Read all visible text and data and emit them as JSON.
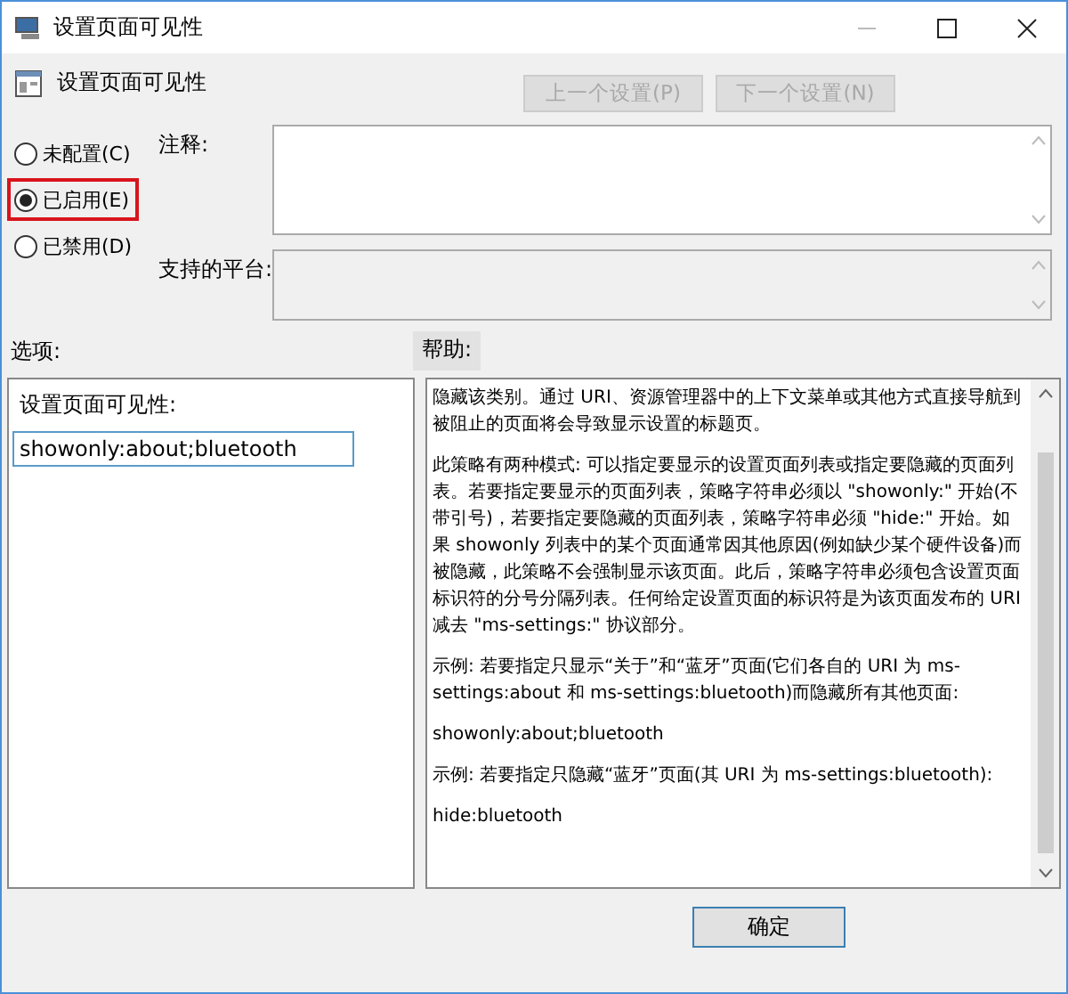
{
  "window": {
    "title": "设置页面可见性"
  },
  "header": {
    "title": "设置页面可见性",
    "buttons": [
      {
        "label": "上一个设置(P)",
        "disabled": true
      },
      {
        "label": "下一个设置(N)",
        "disabled": true
      }
    ]
  },
  "state_options": [
    {
      "label": "未配置(C)",
      "selected": false,
      "highlighted": false
    },
    {
      "label": "已启用(E)",
      "selected": true,
      "highlighted": true
    },
    {
      "label": "已禁用(D)",
      "selected": false,
      "highlighted": false
    }
  ],
  "comment": {
    "label": "注释:"
  },
  "platform": {
    "label": "支持的平台:"
  },
  "options": {
    "label": "选项:",
    "field_label": "设置页面可见性:",
    "value": "showonly:about;bluetooth"
  },
  "help": {
    "label": "帮助:",
    "paragraphs": [
      "隐藏该类别。通过 URI、资源管理器中的上下文菜单或其他方式直接导航到被阻止的页面将会导致显示设置的标题页。",
      "此策略有两种模式: 可以指定要显示的设置页面列表或指定要隐藏的页面列表。若要指定要显示的页面列表，策略字符串必须以 \"showonly:\" 开始(不带引号)，若要指定要隐藏的页面列表，策略字符串必须 \"hide:\" 开始。如果 showonly 列表中的某个页面通常因其他原因(例如缺少某个硬件设备)而被隐藏，此策略不会强制显示该页面。此后，策略字符串必须包含设置页面标识符的分号分隔列表。任何给定设置页面的标识符是为该页面发布的 URI 减去 \"ms-settings:\" 协议部分。",
      "示例: 若要指定只显示“关于”和“蓝牙”页面(它们各自的 URI 为 ms-settings:about 和 ms-settings:bluetooth)而隐藏所有其他页面:",
      "showonly:about;bluetooth",
      "示例: 若要指定只隐藏“蓝牙”页面(其 URI 为 ms-settings:bluetooth):",
      "hide:bluetooth"
    ]
  },
  "buttons": [
    {
      "label": "确定"
    }
  ]
}
